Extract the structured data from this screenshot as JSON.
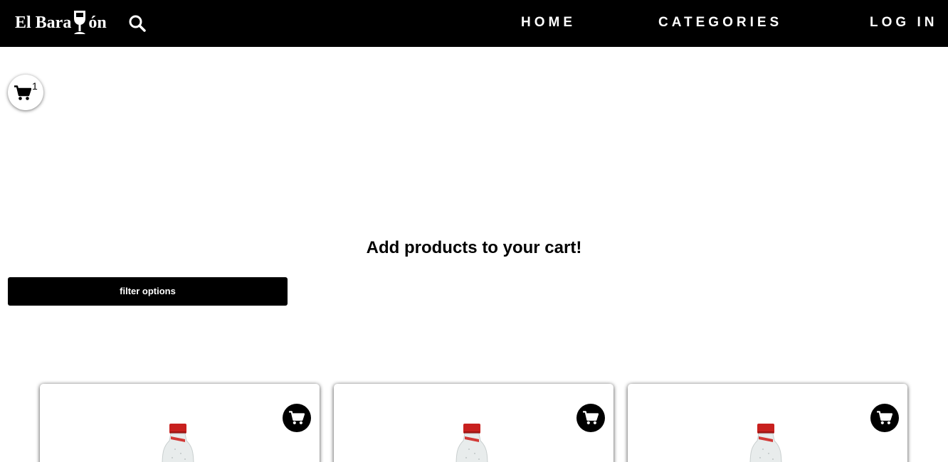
{
  "header": {
    "logo_text_left": "El Bara",
    "logo_text_right": "ón",
    "nav": {
      "home": "HOME",
      "categories": "CATEGORIES",
      "login": "LOG IN"
    }
  },
  "cart": {
    "count": "1"
  },
  "main": {
    "heading": "Add products to your cart!",
    "filter_label": "filter options"
  },
  "products": [
    {
      "image": "soda-bottle",
      "icon": "cart-icon"
    },
    {
      "image": "soda-bottle",
      "icon": "cart-icon"
    },
    {
      "image": "soda-bottle",
      "icon": "cart-icon"
    }
  ],
  "colors": {
    "navbar_bg": "#000000",
    "accent": "#000000",
    "bottle_cap": "#c8201e"
  }
}
